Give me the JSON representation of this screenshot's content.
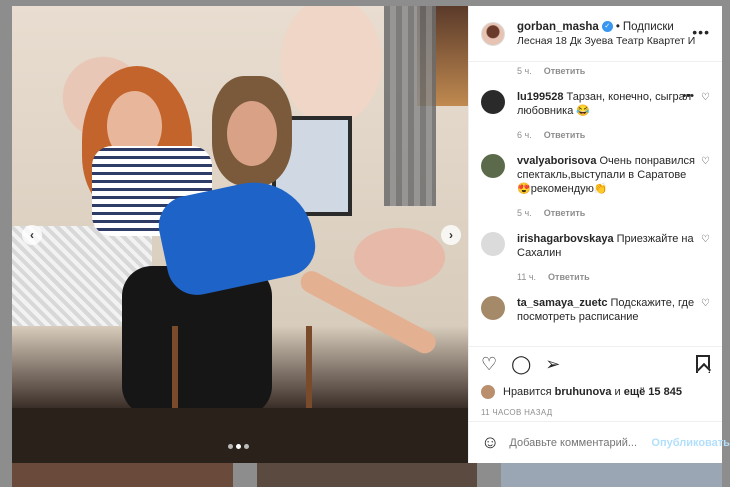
{
  "post": {
    "username": "gorban_masha",
    "follow_label": "Подписки",
    "location": "Лесная 18 Дк Зуева Театр Квартет И",
    "more_icon": "more-horizontal-icon"
  },
  "comments_prev_time": "5 ч.",
  "comments_prev_reply": "Ответить",
  "comments": [
    {
      "user": "lu199528",
      "text": "Тарзан, конечно, сыграл любовника 😂",
      "time": "6 ч.",
      "reply": "Ответить",
      "avatar_color": "#2a2a2a"
    },
    {
      "user": "vvalyaborisova",
      "text": "Очень понравился спектакль,выступали в Саратове 😍рекомендую👏",
      "time": "5 ч.",
      "reply": "Ответить",
      "avatar_color": "#5a6a4a"
    },
    {
      "user": "irishagarbovskaya",
      "text": "Приезжайте на Сахалин",
      "time": "11 ч.",
      "reply": "Ответить",
      "avatar_color": "#dbdbdb"
    },
    {
      "user": "ta_samaya_zuetc",
      "text": "Подскажите, где посмотреть расписание",
      "time": "",
      "reply": "",
      "avatar_color": "#a58a6a"
    }
  ],
  "likes": {
    "prefix": "Нравится",
    "user": "bruhunova",
    "middle": "и",
    "count_text": "ещё 15 845"
  },
  "time_ago": "11 ЧАСОВ НАЗАД",
  "comment_box": {
    "placeholder": "Добавьте комментарий...",
    "publish": "Опубликовать"
  },
  "colors": {
    "link": "#3897f0",
    "publish_disabled": "#b2dffc"
  }
}
